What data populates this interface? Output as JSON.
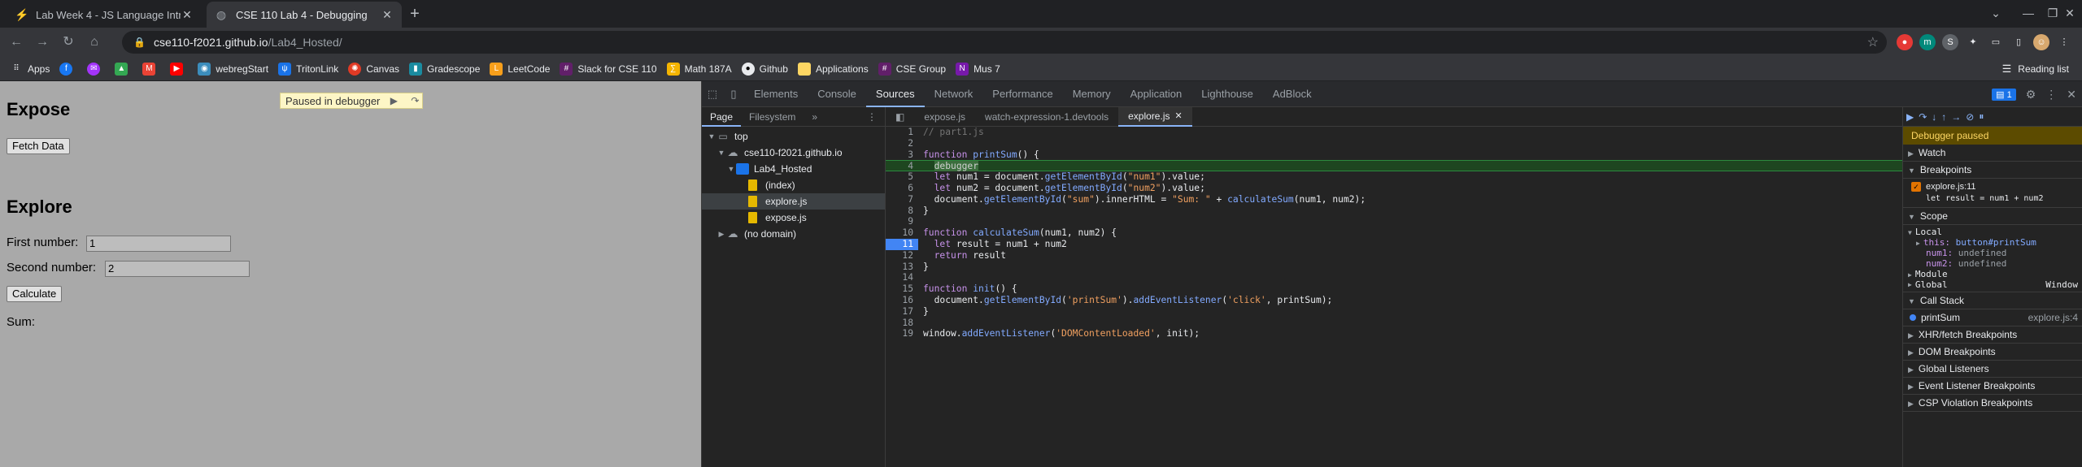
{
  "browser": {
    "tabs": [
      {
        "label": "Lab Week 4 - JS Language Intro",
        "icon": "lightning-icon",
        "active": false
      },
      {
        "label": "CSE 110 Lab 4 - Debugging",
        "icon": "globe-icon",
        "active": true
      }
    ],
    "new_tab_label": "+",
    "url_host": "cse110-f2021.github.io",
    "url_path": "/Lab4_Hosted/",
    "bookmarks": [
      {
        "label": "Apps",
        "icon": "apps-grid-icon",
        "color": "#e8eaed"
      },
      {
        "label": "",
        "icon": "facebook-icon",
        "color": "#1877f2"
      },
      {
        "label": "",
        "icon": "messenger-icon",
        "color": "#a334fa"
      },
      {
        "label": "",
        "icon": "google-drive-icon",
        "color": "#34a853"
      },
      {
        "label": "",
        "icon": "gmail-icon",
        "color": "#ea4335"
      },
      {
        "label": "",
        "icon": "youtube-icon",
        "color": "#ff0000"
      },
      {
        "label": "webregStart",
        "icon": "eye-icon",
        "color": "#3c8dbc"
      },
      {
        "label": "TritonLink",
        "icon": "tritonlink-icon",
        "color": "#1a73e8"
      },
      {
        "label": "Canvas",
        "icon": "canvas-icon",
        "color": "#e03a25"
      },
      {
        "label": "Gradescope",
        "icon": "gradescope-icon",
        "color": "#1a8ba0"
      },
      {
        "label": "LeetCode",
        "icon": "leetcode-icon",
        "color": "#f89f1b"
      },
      {
        "label": "Slack for CSE 110",
        "icon": "slack-icon",
        "color": "#611f69"
      },
      {
        "label": "Math 187A",
        "icon": "math-icon",
        "color": "#f4b400"
      },
      {
        "label": "Github",
        "icon": "github-icon",
        "color": "#e8eaed"
      },
      {
        "label": "Applications",
        "icon": "folder-icon",
        "color": "#fdd663"
      },
      {
        "label": "CSE Group",
        "icon": "slack-icon",
        "color": "#611f69"
      },
      {
        "label": "Mus 7",
        "icon": "onenote-icon",
        "color": "#7719aa"
      }
    ],
    "reading_list": "Reading list"
  },
  "page": {
    "expose_heading": "Expose",
    "fetch_button": "Fetch Data",
    "explore_heading": "Explore",
    "first_label": "First number:",
    "first_value": "1",
    "second_label": "Second number:",
    "second_value": "2",
    "calculate_button": "Calculate",
    "sum_label": "Sum:",
    "paused_badge": "Paused in debugger"
  },
  "devtools": {
    "tabs": [
      "Elements",
      "Console",
      "Sources",
      "Network",
      "Performance",
      "Memory",
      "Application",
      "Lighthouse",
      "AdBlock"
    ],
    "active_tab": "Sources",
    "issues_count": "1",
    "navigator_tabs": [
      "Page",
      "Filesystem"
    ],
    "tree": [
      {
        "label": "top",
        "type": "frame",
        "depth": 0
      },
      {
        "label": "cse110-f2021.github.io",
        "type": "cloud",
        "depth": 1
      },
      {
        "label": "Lab4_Hosted",
        "type": "folder",
        "depth": 2
      },
      {
        "label": "(index)",
        "type": "file",
        "depth": 3
      },
      {
        "label": "explore.js",
        "type": "file",
        "depth": 3,
        "selected": true
      },
      {
        "label": "expose.js",
        "type": "file",
        "depth": 3
      },
      {
        "label": "(no domain)",
        "type": "cloud",
        "depth": 1
      }
    ],
    "editor_tabs": [
      {
        "label": "expose.js",
        "active": false
      },
      {
        "label": "watch-expression-1.devtools",
        "active": false
      },
      {
        "label": "explore.js",
        "active": true
      }
    ],
    "code_lines": [
      "// part1.js",
      "",
      "function printSum() {",
      "  debugger",
      "  let num1 = document.getElementById(\"num1\").value;",
      "  let num2 = document.getElementById(\"num2\").value;",
      "  document.getElementById(\"sum\").innerHTML = \"Sum: \" + calculateSum(num1, num2);",
      "}",
      "",
      "function calculateSum(num1, num2) {",
      "  let result = num1 + num2",
      "  return result",
      "}",
      "",
      "function init() {",
      "  document.getElementById('printSum').addEventListener('click', printSum);",
      "}",
      "",
      "window.addEventListener('DOMContentLoaded', init);"
    ],
    "paused_line": 4,
    "breakpoint_line": 11,
    "sidebar": {
      "paused_banner": "Debugger paused",
      "watch": "Watch",
      "breakpoints": "Breakpoints",
      "bp_file": "explore.js:11",
      "bp_code": "let result = num1 + num2",
      "scope": "Scope",
      "local": "Local",
      "this_name": "this:",
      "this_value": "button#printSum",
      "num1_name": "num1:",
      "num1_value": "undefined",
      "num2_name": "num2:",
      "num2_value": "undefined",
      "module": "Module",
      "global": "Global",
      "global_value": "Window",
      "call_stack": "Call Stack",
      "frame_name": "printSum",
      "frame_loc": "explore.js:4",
      "xhr": "XHR/fetch Breakpoints",
      "dom": "DOM Breakpoints",
      "global_listeners": "Global Listeners",
      "event_listeners": "Event Listener Breakpoints",
      "csp": "CSP Violation Breakpoints"
    }
  }
}
